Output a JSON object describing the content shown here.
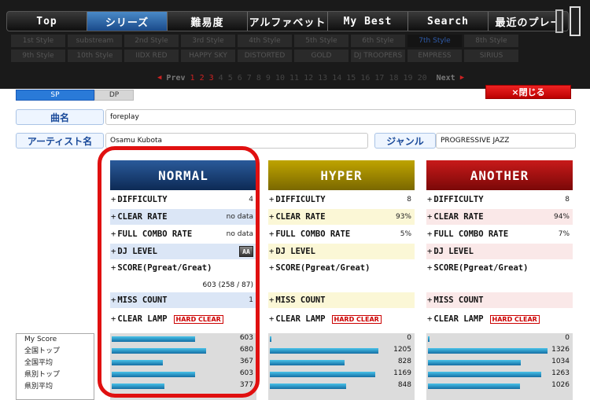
{
  "nav": {
    "tabs": [
      {
        "label": "Top",
        "active": false
      },
      {
        "label": "シリーズ",
        "active": true
      },
      {
        "label": "難易度",
        "active": false
      },
      {
        "label": "アルファベット",
        "active": false
      },
      {
        "label": "My Best",
        "active": false
      },
      {
        "label": "Search",
        "active": false
      },
      {
        "label": "最近のプレー",
        "active": false
      }
    ]
  },
  "styles": {
    "row1": [
      "1st Style",
      "substream",
      "2nd Style",
      "3rd Style",
      "4th Style",
      "5th Style",
      "6th Style",
      "7th Style",
      "8th Style"
    ],
    "row2": [
      "9th Style",
      "10th Style",
      "IIDX RED",
      "HAPPY SKY",
      "DISTORTED",
      "GOLD",
      "DJ TROOPERS",
      "EMPRESS",
      "SIRIUS"
    ],
    "active": "7th Style"
  },
  "pager": {
    "prev": "Prev",
    "next": "Next",
    "pages": [
      "1",
      "2",
      "3",
      "4",
      "5",
      "6",
      "7",
      "8",
      "9",
      "10",
      "11",
      "12",
      "13",
      "14",
      "15",
      "16",
      "17",
      "18",
      "19",
      "20"
    ],
    "current": "1"
  },
  "mode": {
    "sp": "SP",
    "dp": "DP",
    "close": "×閉じる"
  },
  "song": {
    "title_label": "曲名",
    "title": "foreplay",
    "artist_label": "アーティスト名",
    "artist": "Osamu Kubota",
    "genre_label": "ジャンル",
    "genre": "PROGRESSIVE JAZZ"
  },
  "labels": {
    "difficulty": "DIFFICULTY",
    "clear_rate": "CLEAR RATE",
    "full_combo_rate": "FULL COMBO RATE",
    "dj_level": "DJ LEVEL",
    "score": "SCORE(Pgreat/Great)",
    "miss_count": "MISS COUNT",
    "clear_lamp": "CLEAR LAMP",
    "plus": "+"
  },
  "charts": [
    {
      "name": "NORMAL",
      "difficulty": "4",
      "clear_rate": "no data",
      "full_combo_rate": "no data",
      "dj_level": "AA",
      "score": "603 (258 / 87)",
      "miss_count": "1",
      "clear_lamp": "HARD CLEAR"
    },
    {
      "name": "HYPER",
      "difficulty": "8",
      "clear_rate": "93%",
      "full_combo_rate": "5%",
      "dj_level": "",
      "score": "",
      "miss_count": "",
      "clear_lamp": "HARD CLEAR"
    },
    {
      "name": "ANOTHER",
      "difficulty": "8",
      "clear_rate": "94%",
      "full_combo_rate": "7%",
      "dj_level": "",
      "score": "",
      "miss_count": "",
      "clear_lamp": "HARD CLEAR"
    }
  ],
  "score_rows": [
    "My Score",
    "全国トップ",
    "全国平均",
    "県別トップ",
    "県別平均"
  ],
  "scores": {
    "normal": [
      603,
      680,
      367,
      603,
      377
    ],
    "hyper": [
      0,
      1205,
      828,
      1169,
      848
    ],
    "another": [
      0,
      1326,
      1034,
      1263,
      1026
    ]
  },
  "colors": {
    "normal": "#1a3f78",
    "hyper": "#9a8400",
    "another": "#a01010",
    "highlight": "#e01010"
  }
}
